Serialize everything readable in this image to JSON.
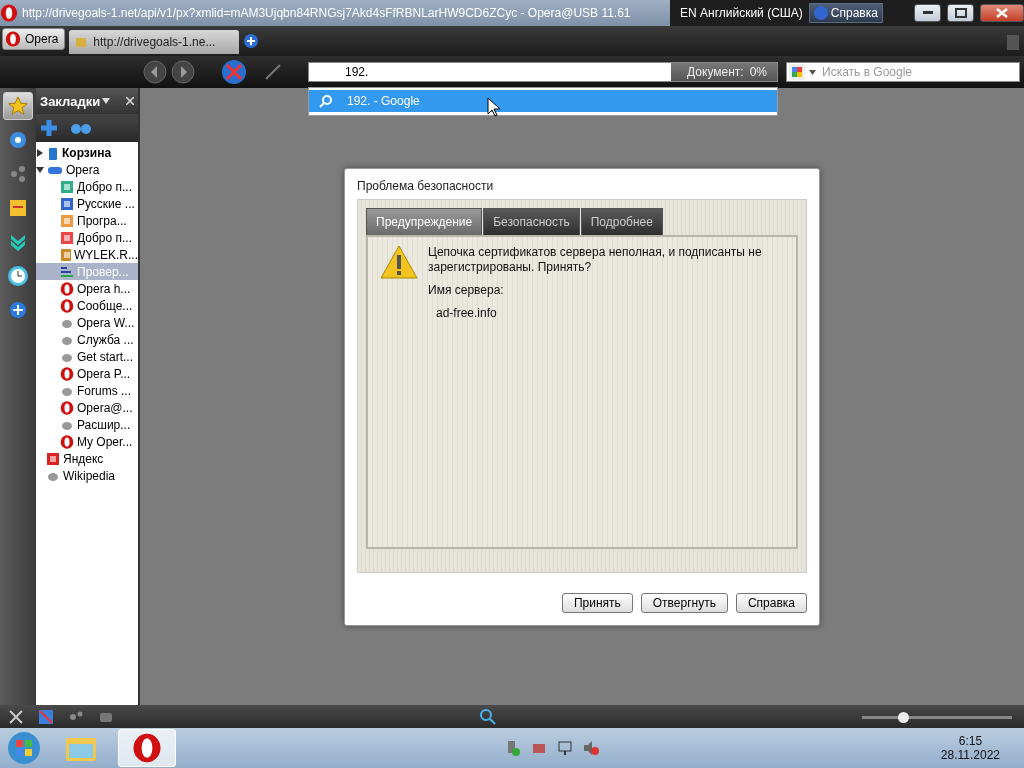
{
  "title_bar": {
    "title": "http://drivegoals-1.net/api/v1/px?xmlid=mAM3Ujqbn84RNGsj7Akd4sFfRBNLarHW9CD6ZCyc - Opera@USB 11.61",
    "language": "EN Английский (США)",
    "help": "Справка"
  },
  "tab_bar": {
    "menu": "Opera",
    "tabs": [
      {
        "label": "http://drivegoals-1.ne...",
        "selected": true
      }
    ]
  },
  "address_bar": {
    "value": "192.",
    "progress_label": "Документ:",
    "progress": "0%"
  },
  "search": {
    "placeholder": "Искать в Google"
  },
  "suggestions": [
    {
      "text": "192. - Google",
      "selected": true
    }
  ],
  "panel_buttons": [
    {
      "kind": "star",
      "selected": true
    },
    {
      "kind": "gear",
      "selected": false
    },
    {
      "kind": "share",
      "selected": false
    },
    {
      "kind": "note",
      "selected": false
    },
    {
      "kind": "download",
      "selected": false
    },
    {
      "kind": "clock",
      "selected": false
    },
    {
      "kind": "plus",
      "selected": false
    }
  ],
  "bookmarks": {
    "title": "Закладки",
    "tree": [
      {
        "label": "Корзина",
        "kind": "trash",
        "expanded": false,
        "selected": false
      },
      {
        "label": "Opera",
        "kind": "folder",
        "expanded": true,
        "selected": false,
        "children": [
          {
            "label": "Добро п...",
            "kind": "windows",
            "selected": false
          },
          {
            "label": "Русские ...",
            "kind": "computer",
            "selected": false
          },
          {
            "label": "Програ...",
            "kind": "program",
            "selected": false
          },
          {
            "label": "Добро п...",
            "kind": "joomla",
            "selected": false
          },
          {
            "label": "WYLEK.R...",
            "kind": "wylek",
            "selected": false
          },
          {
            "label": "Провер...",
            "kind": "list",
            "selected": true
          },
          {
            "label": "Opera h...",
            "kind": "opera",
            "selected": false
          },
          {
            "label": "Сообще...",
            "kind": "opera",
            "selected": false
          },
          {
            "label": "Opera W...",
            "kind": "globe",
            "selected": false
          },
          {
            "label": "Служба ...",
            "kind": "globe",
            "selected": false
          },
          {
            "label": "Get start...",
            "kind": "globe",
            "selected": false
          },
          {
            "label": "Opera P...",
            "kind": "opera",
            "selected": false
          },
          {
            "label": "Forums ...",
            "kind": "globe",
            "selected": false
          },
          {
            "label": "Opera@...",
            "kind": "operausb",
            "selected": false
          },
          {
            "label": "Расшир...",
            "kind": "globe",
            "selected": false
          },
          {
            "label": "My Oper...",
            "kind": "opera",
            "selected": false
          }
        ]
      },
      {
        "label": "Яндекс",
        "kind": "yandex",
        "selected": false
      },
      {
        "label": "Wikipedia",
        "kind": "globe",
        "selected": false
      }
    ]
  },
  "dialog": {
    "title": "Проблема безопасности",
    "tabs": [
      {
        "label": "Предупреждение",
        "selected": true
      },
      {
        "label": "Безопасность",
        "selected": false
      },
      {
        "label": "Подробнее",
        "selected": false
      }
    ],
    "message": "Цепочка сертификатов сервера неполная, и подписанты не зарегистрированы. Принять?",
    "server_label": "Имя сервера:",
    "server": "ad-free.info",
    "buttons": [
      "Принять",
      "Отвергнуть",
      "Справка"
    ]
  },
  "status_bar": {
    "zoom": {
      "level": 0.27
    }
  },
  "taskbar": {
    "apps": [
      {
        "kind": "explorer",
        "selected": false
      },
      {
        "kind": "opera",
        "selected": true
      }
    ],
    "time": "6:15",
    "date": "28.11.2022"
  }
}
